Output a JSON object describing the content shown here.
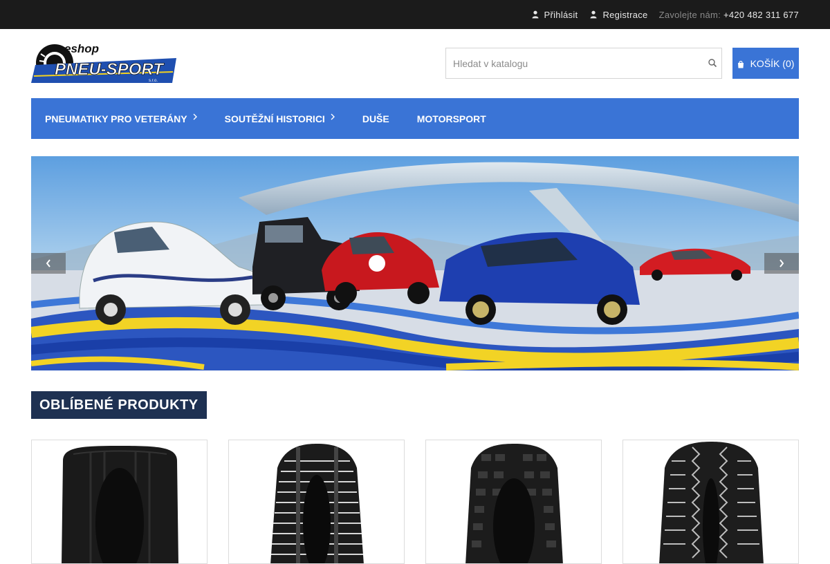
{
  "topbar": {
    "login_label": "Přihlásit",
    "register_label": "Registrace",
    "call_label": "Zavolejte nám:",
    "phone": "+420 482 311 677"
  },
  "logo": {
    "small_text": "eshop",
    "brand_text": "PNEU-SPORT",
    "suffix_text": "s.r.o."
  },
  "search": {
    "placeholder": "Hledat v katalogu",
    "icon": "search-icon"
  },
  "cart": {
    "label": "KOŠÍK (0)",
    "icon": "cart-icon"
  },
  "nav": {
    "items": [
      {
        "label": "PNEUMATIKY PRO VETERÁNY",
        "has_dropdown": true
      },
      {
        "label": "SOUTĚŽNÍ HISTORICI",
        "has_dropdown": true
      },
      {
        "label": "DUŠE",
        "has_dropdown": false
      },
      {
        "label": "MOTORSPORT",
        "has_dropdown": false
      }
    ]
  },
  "section": {
    "title": "OBLÍBENÉ PRODUKTY"
  },
  "colors": {
    "topbar": "#1b1b1b",
    "accent": "#3a74d6",
    "section_title": "#1e3152"
  }
}
